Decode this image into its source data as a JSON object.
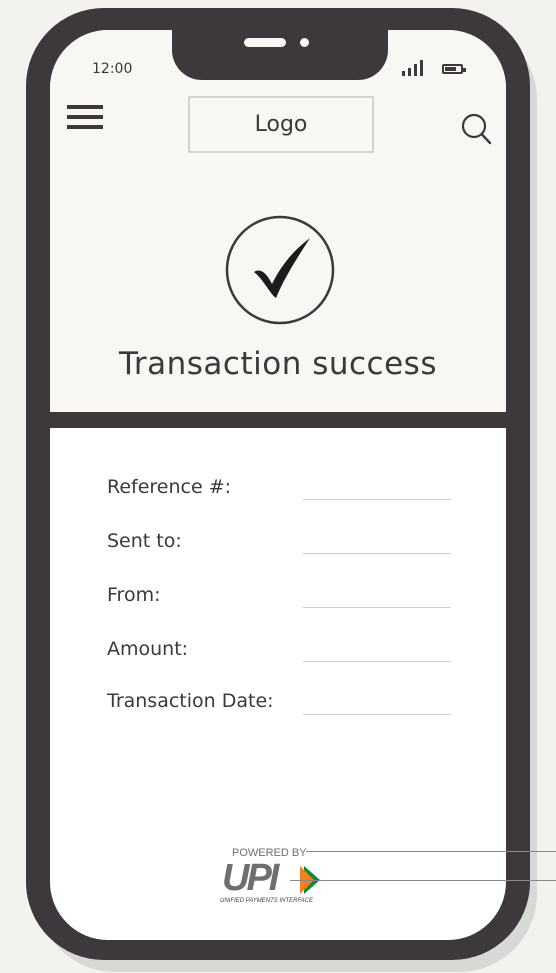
{
  "status_bar": {
    "time": "12:00"
  },
  "header": {
    "logo": "Logo"
  },
  "hero": {
    "title": "Transaction success"
  },
  "details": [
    {
      "label": "Reference #:"
    },
    {
      "label": "Sent to:"
    },
    {
      "label": "From:"
    },
    {
      "label": "Amount:"
    },
    {
      "label": "Transaction Date:"
    }
  ],
  "footer": {
    "powered_by": "POWERED BY",
    "brand": "UPI",
    "brand_full": "UNIFIED PAYMENTS INTERFACE"
  },
  "colors": {
    "frame": "#3c383b",
    "screen_top": "#f8f7f3",
    "screen_body": "#ffffff",
    "upi_orange": "#f58220",
    "upi_green": "#0b8a3e"
  },
  "icons": [
    "menu-icon",
    "search-icon",
    "checkmark-icon",
    "signal-icon",
    "battery-icon",
    "upi-logo"
  ]
}
